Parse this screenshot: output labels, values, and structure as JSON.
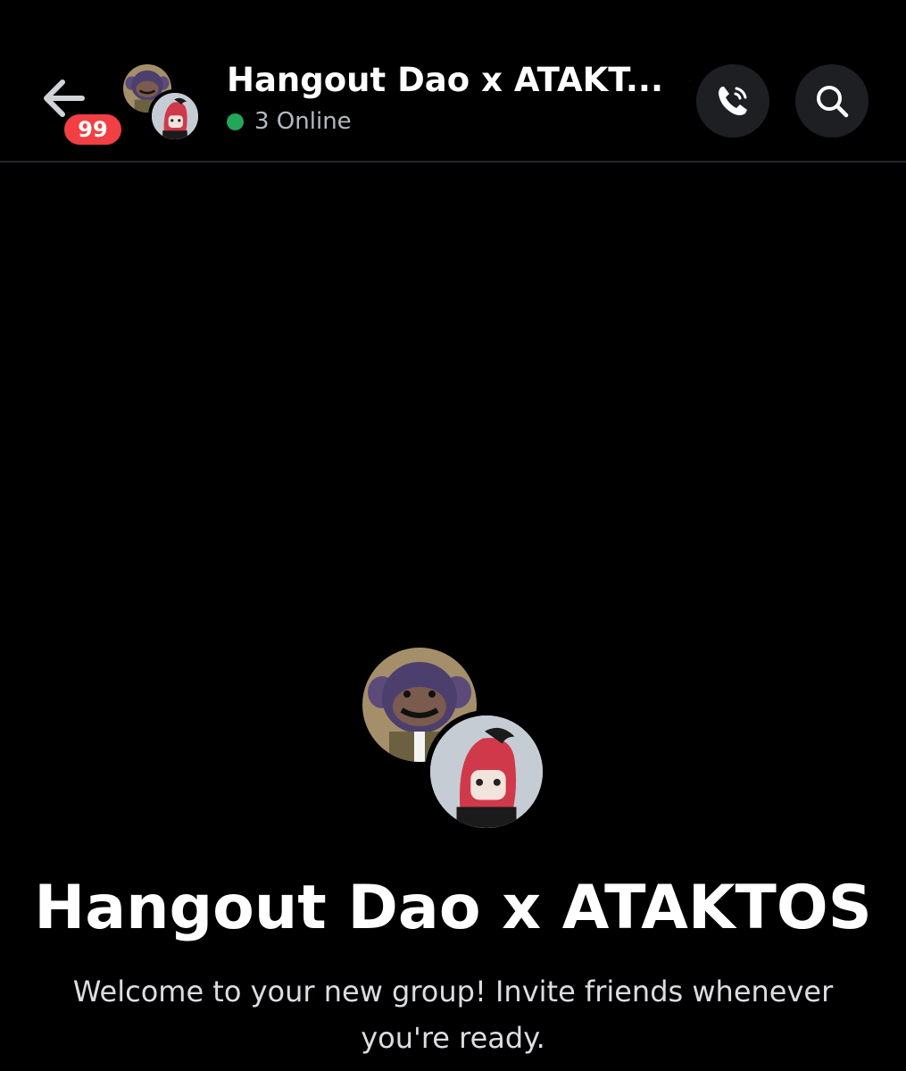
{
  "header": {
    "unread_badge": "99",
    "title": "Hangout Dao x ATAKT...",
    "status_text": "3 Online",
    "back_icon": "arrow-left-icon",
    "chevron_icon": "chevron-right-icon",
    "call_icon": "phone-call-icon",
    "search_icon": "search-icon"
  },
  "main": {
    "group_name": "Hangout Dao x ATAKTOS",
    "welcome_text": "Welcome to your new group! Invite friends whenever you're ready."
  },
  "colors": {
    "background": "#000000",
    "badge": "#f23f43",
    "online": "#23a55a",
    "button_bg": "#1e1f22",
    "muted_text": "#b5bac1"
  }
}
